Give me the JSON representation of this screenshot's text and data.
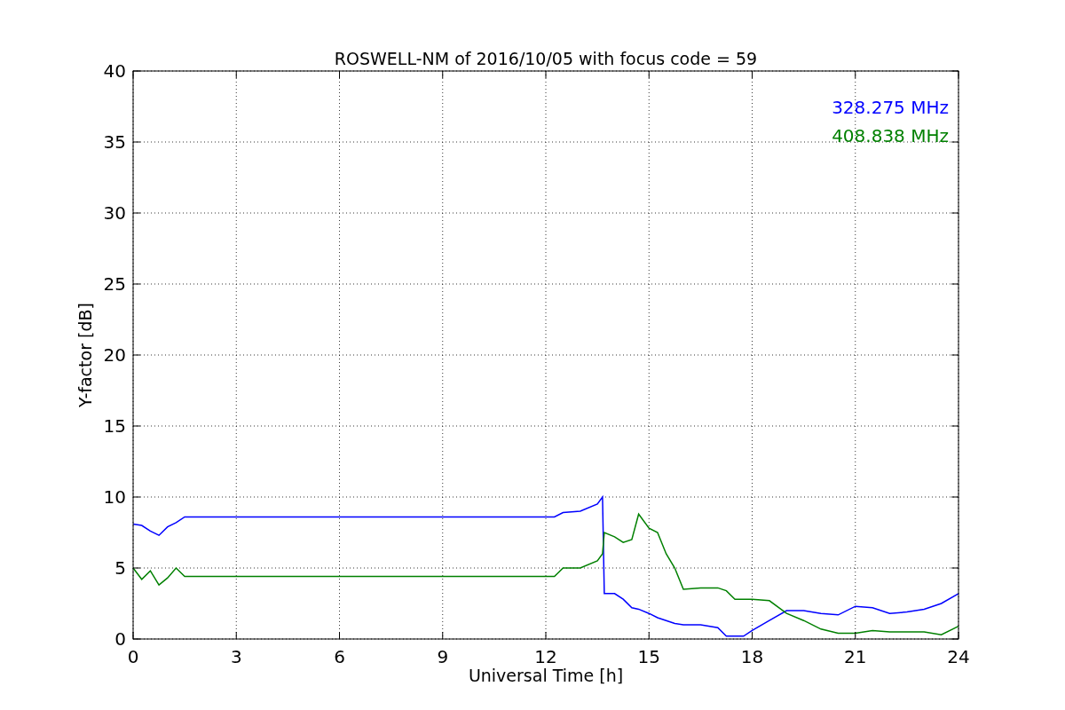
{
  "chart_data": {
    "type": "line",
    "title": "ROSWELL-NM of 2016/10/05 with focus code = 59",
    "xlabel": "Universal Time [h]",
    "ylabel": "Y-factor [dB]",
    "x": [
      0,
      0.25,
      0.5,
      0.75,
      1,
      1.25,
      1.5,
      12.25,
      12.5,
      13,
      13.5,
      13.65,
      13.7,
      14,
      14.25,
      14.5,
      14.7,
      15,
      15.25,
      15.5,
      15.75,
      16,
      16.5,
      17,
      17.25,
      17.5,
      17.75,
      18,
      18.5,
      19,
      19.5,
      20,
      20.5,
      21,
      21.5,
      22,
      22.5,
      23,
      23.5,
      24
    ],
    "series": [
      {
        "name": "328.275 MHz",
        "color": "#0000ff",
        "values": [
          8.1,
          8.0,
          7.6,
          7.3,
          7.9,
          8.2,
          8.6,
          8.6,
          8.9,
          9.0,
          9.5,
          10.0,
          3.2,
          3.2,
          2.8,
          2.2,
          2.1,
          1.8,
          1.5,
          1.3,
          1.1,
          1.0,
          1.0,
          0.8,
          0.2,
          0.2,
          0.2,
          0.6,
          1.3,
          2.0,
          2.0,
          1.8,
          1.7,
          2.3,
          2.2,
          1.8,
          1.9,
          2.1,
          2.5,
          3.2
        ]
      },
      {
        "name": "408.838 MHz",
        "color": "#008000",
        "values": [
          5.0,
          4.2,
          4.8,
          3.8,
          4.3,
          5.0,
          4.4,
          4.4,
          5.0,
          5.0,
          5.5,
          6.0,
          7.5,
          7.2,
          6.8,
          7.0,
          8.8,
          7.8,
          7.5,
          6.0,
          5.0,
          3.5,
          3.6,
          3.6,
          3.4,
          2.8,
          2.8,
          2.8,
          2.7,
          1.8,
          1.3,
          0.7,
          0.4,
          0.4,
          0.6,
          0.5,
          0.5,
          0.5,
          0.3,
          0.9
        ]
      }
    ],
    "xlim": [
      0,
      24
    ],
    "ylim": [
      0,
      40
    ],
    "grid": true,
    "xticks": [
      0,
      3,
      6,
      9,
      12,
      15,
      18,
      21,
      24
    ],
    "yticks": [
      0,
      5,
      10,
      15,
      20,
      25,
      30,
      35,
      40
    ]
  }
}
